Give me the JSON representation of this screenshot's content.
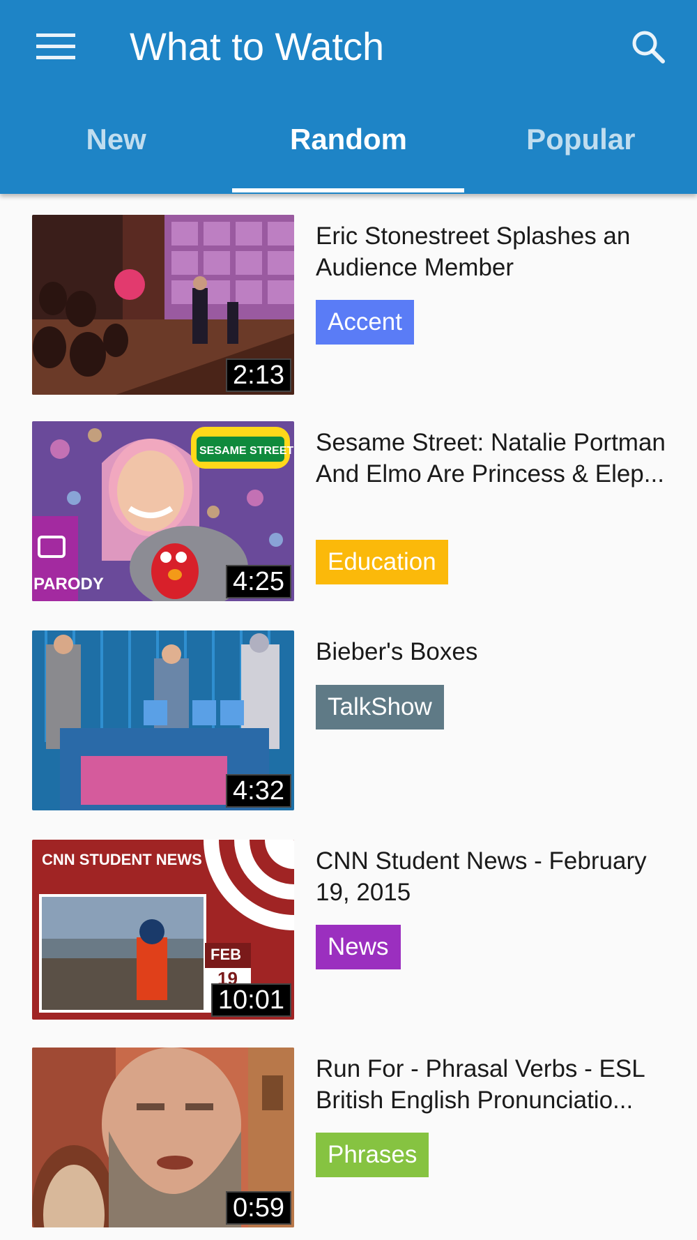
{
  "header": {
    "title": "What to Watch",
    "menu_icon": "hamburger-menu-icon",
    "search_icon": "search-icon",
    "background": "#1e84c6"
  },
  "tabs": [
    {
      "label": "New",
      "active": false
    },
    {
      "label": "Random",
      "active": true
    },
    {
      "label": "Popular",
      "active": false
    }
  ],
  "videos": [
    {
      "title": "Eric Stonestreet Splashes an Audience Member",
      "duration": "2:13",
      "tag": "Accent",
      "tag_color": "#5a7cf6"
    },
    {
      "title": "Sesame Street: Natalie Portman And Elmo Are Princess & Elep...",
      "duration": "4:25",
      "tag": "Education",
      "tag_color": "#fbb90a",
      "thumb_badge": "PARODY",
      "thumb_logo": "SESAME STREET"
    },
    {
      "title": "Bieber's Boxes",
      "duration": "4:32",
      "tag": "TalkShow",
      "tag_color": "#5f7a86"
    },
    {
      "title": "CNN Student News - February 19, 2015",
      "duration": "10:01",
      "tag": "News",
      "tag_color": "#9b2fbf",
      "thumb_header": "CNN STUDENT NEWS",
      "thumb_date_month": "FEB",
      "thumb_date_day": "19"
    },
    {
      "title": "Run For - Phrasal Verbs - ESL British English Pronunciatio...",
      "duration": "0:59",
      "tag": "Phrases",
      "tag_color": "#86c341"
    }
  ]
}
